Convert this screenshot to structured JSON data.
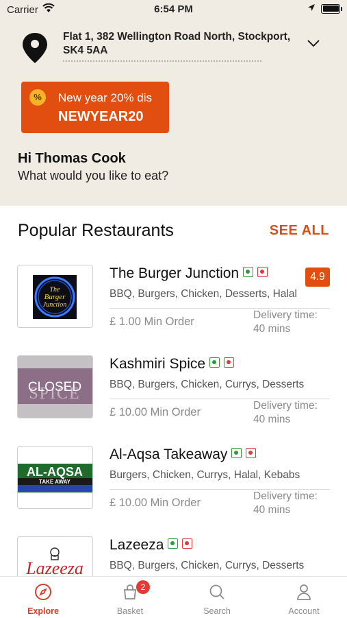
{
  "status_bar": {
    "carrier": "Carrier",
    "time": "6:54 PM"
  },
  "location": {
    "address_line1": "Flat 1, 382 Wellington Road North, Stockport,",
    "address_line2": "SK4 5AA"
  },
  "promo": {
    "badge": "%",
    "text": "New year 20% dis",
    "code": "NEWYEAR20"
  },
  "greeting": {
    "name": "Hi Thomas Cook",
    "subtitle": "What would you like to eat?"
  },
  "section": {
    "title": "Popular Restaurants",
    "see_all": "SEE ALL"
  },
  "restaurants": [
    {
      "name": "The Burger Junction",
      "rating": "4.9",
      "tags": "BBQ, Burgers, Chicken, Desserts, Halal",
      "min_order": "£ 1.00 Min Order",
      "delivery_label": "Delivery time:",
      "delivery_time": "40 mins",
      "logo_text": "The Burger Junction"
    },
    {
      "name": "Kashmiri Spice",
      "tags": "BBQ, Burgers, Chicken, Currys, Desserts",
      "min_order": "£ 10.00 Min Order",
      "delivery_label": "Delivery time:",
      "delivery_time": "40 mins",
      "logo_text": "SPICE",
      "closed": "CLOSED"
    },
    {
      "name": "Al-Aqsa Takeaway",
      "tags": "Burgers, Chicken, Currys, Halal, Kebabs",
      "min_order": "£ 10.00 Min Order",
      "delivery_label": "Delivery time:",
      "delivery_time": "40 mins",
      "logo_text": "AL-AQSA",
      "logo_sub": "TAKE AWAY"
    },
    {
      "name": "Lazeeza",
      "tags": "BBQ, Burgers, Chicken, Currys, Desserts",
      "logo_text": "Lazeeza"
    }
  ],
  "tabbar": {
    "explore": "Explore",
    "basket": "Basket",
    "basket_count": "2",
    "search": "Search",
    "account": "Account"
  },
  "colors": {
    "accent": "#e24e10",
    "header_bg": "#f0ece3",
    "veg": "#2f9a3b",
    "nonveg": "#e03a3a"
  }
}
